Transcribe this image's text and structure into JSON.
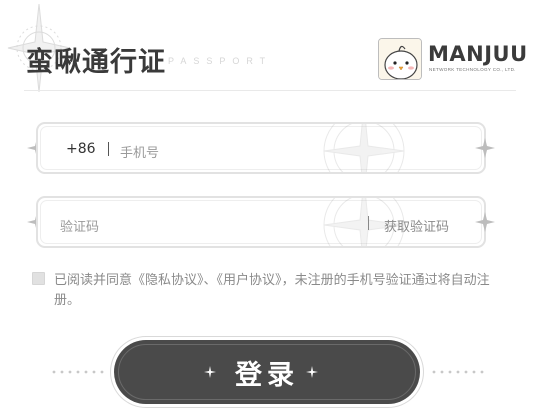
{
  "header": {
    "title": "蛮啾通行证",
    "subtitle": "PASSPORT",
    "brand": {
      "name": "MANJUU",
      "tagline": "NETWORK TECHNOLOGY CO., LTD."
    }
  },
  "phone_field": {
    "prefix": "+86",
    "placeholder": "手机号"
  },
  "code_field": {
    "placeholder": "验证码",
    "get_code_label": "获取验证码"
  },
  "agreement": {
    "text_before": "已阅读并同意",
    "privacy_link": "《隐私协议》",
    "separator": "、",
    "user_link": "《用户协议》",
    "text_after": "，未注册的手机号验证通过将自动注册。",
    "checked": false
  },
  "login_button": {
    "label": "登录",
    "dark_color": "#4a4a4a"
  },
  "icons": [
    "corner-star-icon",
    "manjuu-logo-icon",
    "sparkle-icon"
  ]
}
